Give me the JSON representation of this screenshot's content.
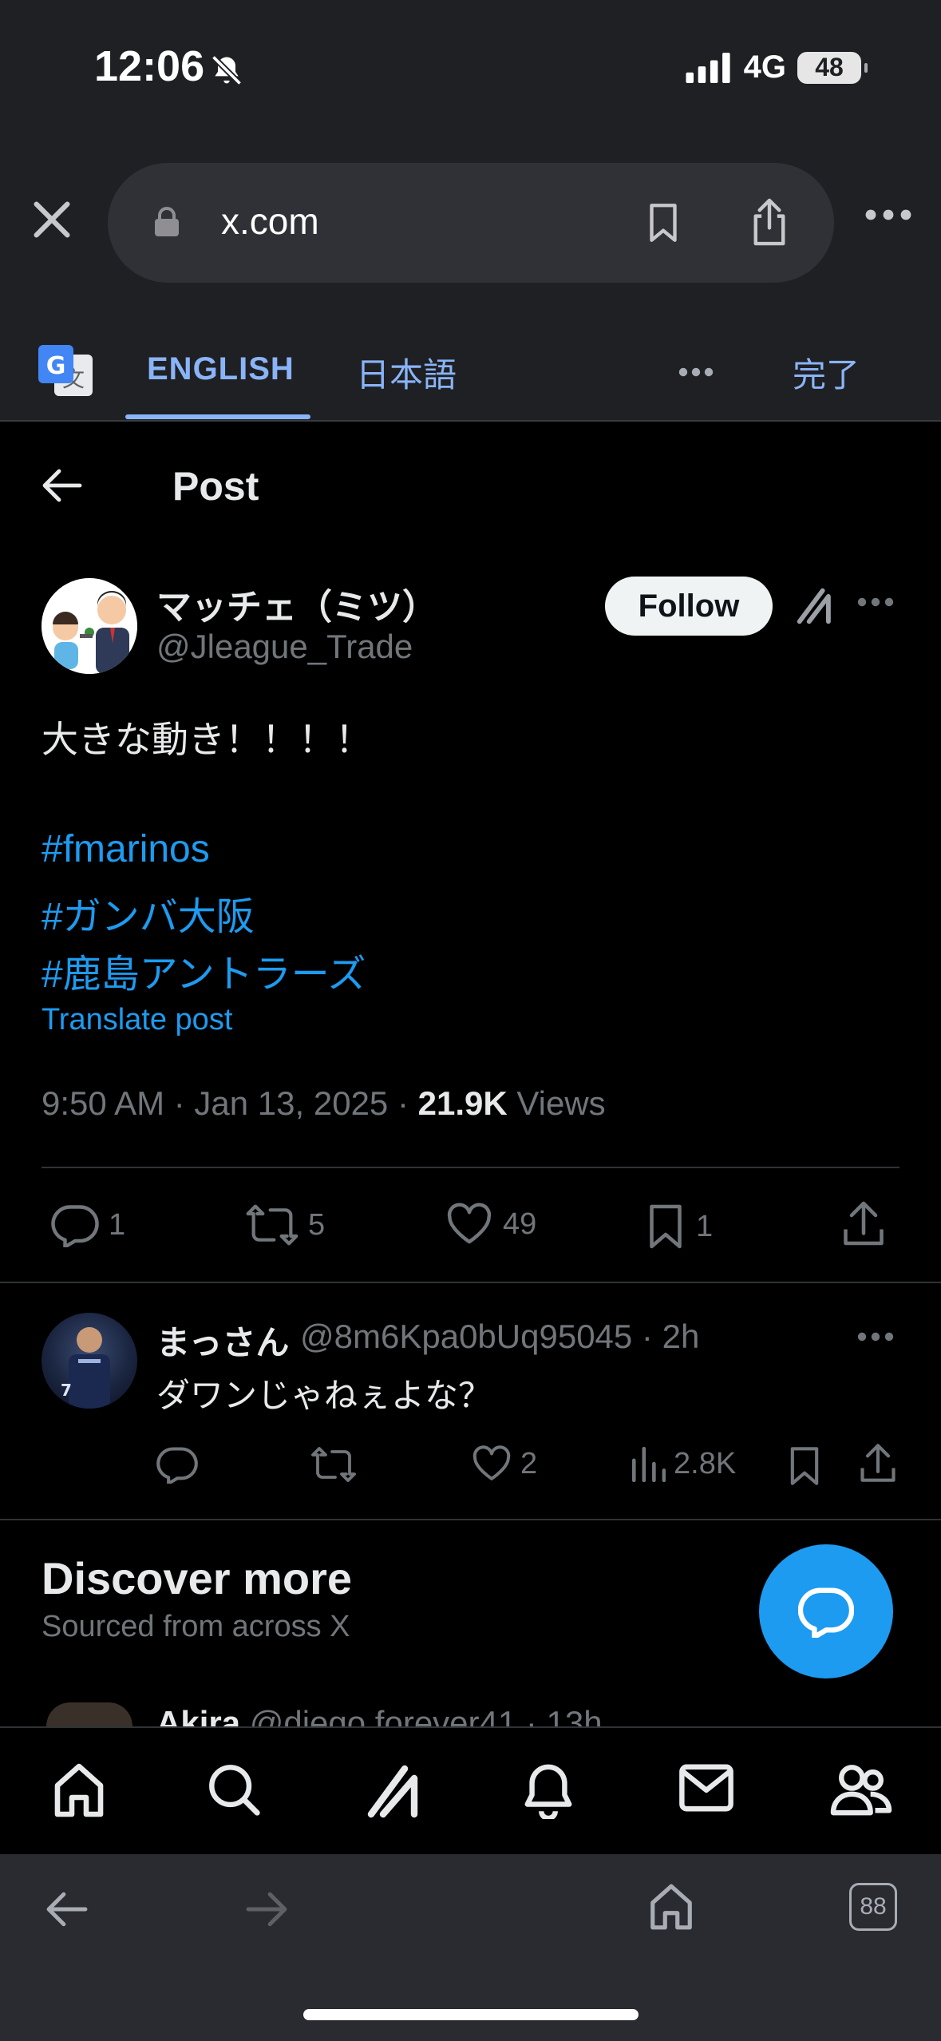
{
  "status_bar": {
    "time": "12:06",
    "network": "4G",
    "battery": "48"
  },
  "browser": {
    "url": "x.com"
  },
  "translate_bar": {
    "tab_english": "ENGLISH",
    "tab_japanese": "日本語",
    "done": "完了"
  },
  "page": {
    "title": "Post"
  },
  "post": {
    "author_name": "マッチェ（ミツ）",
    "author_handle": "@Jleague_Trade",
    "follow_label": "Follow",
    "text": "大きな動き！！！！",
    "hashtags": [
      "#fmarinos",
      "#ガンバ大阪",
      "#鹿島アントラーズ"
    ],
    "translate_label": "Translate post",
    "time": "9:50 AM · Jan 13, 2025 · ",
    "views_count": "21.9K",
    "views_label": " Views",
    "replies": "1",
    "reposts": "5",
    "likes": "49",
    "bookmarks": "1"
  },
  "reply": {
    "name": "まっさん",
    "handle_time": "@8m6Kpa0bUq95045 · 2h",
    "text": "ダワンじゃねぇよな？",
    "likes": "2",
    "views": "2.8K"
  },
  "discover": {
    "title": "Discover more",
    "subtitle": "Sourced from across X",
    "next_name": "Akira",
    "next_handle": " @diego.forever41 · 13h"
  },
  "browser_bottom": {
    "tabs_count": "88"
  },
  "colors": {
    "accent": "#1d9bf0",
    "background": "#000000",
    "muted": "#71767b"
  }
}
